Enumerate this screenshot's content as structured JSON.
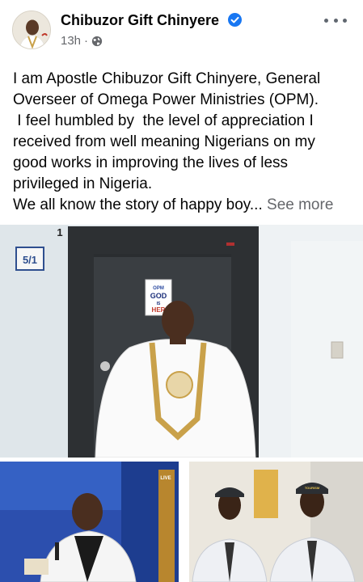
{
  "post": {
    "author": {
      "name": "Chibuzor Gift Chinyere",
      "verified": true,
      "avatar_icon": "profile-photo"
    },
    "timestamp": "13h",
    "separator": "·",
    "audience_icon": "globe-icon",
    "more_icon": "more-horizontal-icon",
    "body_text": "I am Apostle Chibuzor Gift Chinyere, General Overseer of Omega Power Ministries (OPM).\n I feel humbled by  the level of appreciation I received from well meaning Nigerians on my good works in improving the lives of less privileged in Nigeria.\nWe all know the story of happy boy...",
    "see_more_label": "See more"
  },
  "photos": {
    "main": {
      "door_number": "5/1",
      "frame_number": "1",
      "sign_line1": "OPM",
      "sign_line2": "GOD",
      "sign_line3": "IS",
      "sign_line4": "HER"
    },
    "left": {
      "backdrop_text": "LIVE"
    },
    "right": {
      "cap_text": "TOURISM"
    }
  },
  "colors": {
    "verified_badge": "#1877f2",
    "text_primary": "#050505",
    "text_secondary": "#65676b",
    "robe_trim": "#c9a14a"
  }
}
